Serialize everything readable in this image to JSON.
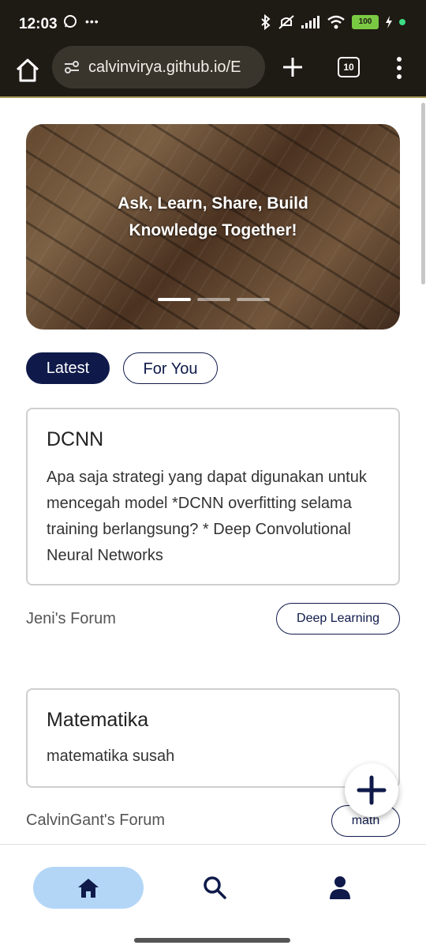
{
  "status_bar": {
    "time": "12:03",
    "more": "•••",
    "battery": "100"
  },
  "browser": {
    "url": "calvinvirya.github.io/E",
    "tab_count": "10"
  },
  "hero": {
    "line1": "Ask, Learn, Share, Build",
    "line2": "Knowledge Together!",
    "slides": 3,
    "active_slide": 1
  },
  "tabs": {
    "latest": "Latest",
    "for_you": "For You"
  },
  "posts": [
    {
      "title": "DCNN",
      "body": "Apa saja strategi yang dapat digunakan untuk mencegah model *DCNN overfitting selama training berlangsung? * Deep Convolutional Neural Networks",
      "forum": "Jeni's Forum",
      "tag": "Deep Learning"
    },
    {
      "title": "Matematika",
      "body": "matematika susah",
      "forum": "CalvinGant's Forum",
      "tag": "math"
    }
  ],
  "colors": {
    "primary": "#0f1a4a",
    "nav_active": "#b3d6f7",
    "status_bar": "#1e1a14",
    "battery": "#7ac943"
  },
  "bottom_nav": {
    "items": [
      "home-icon",
      "search-icon",
      "person-icon"
    ],
    "active": "home-icon"
  }
}
